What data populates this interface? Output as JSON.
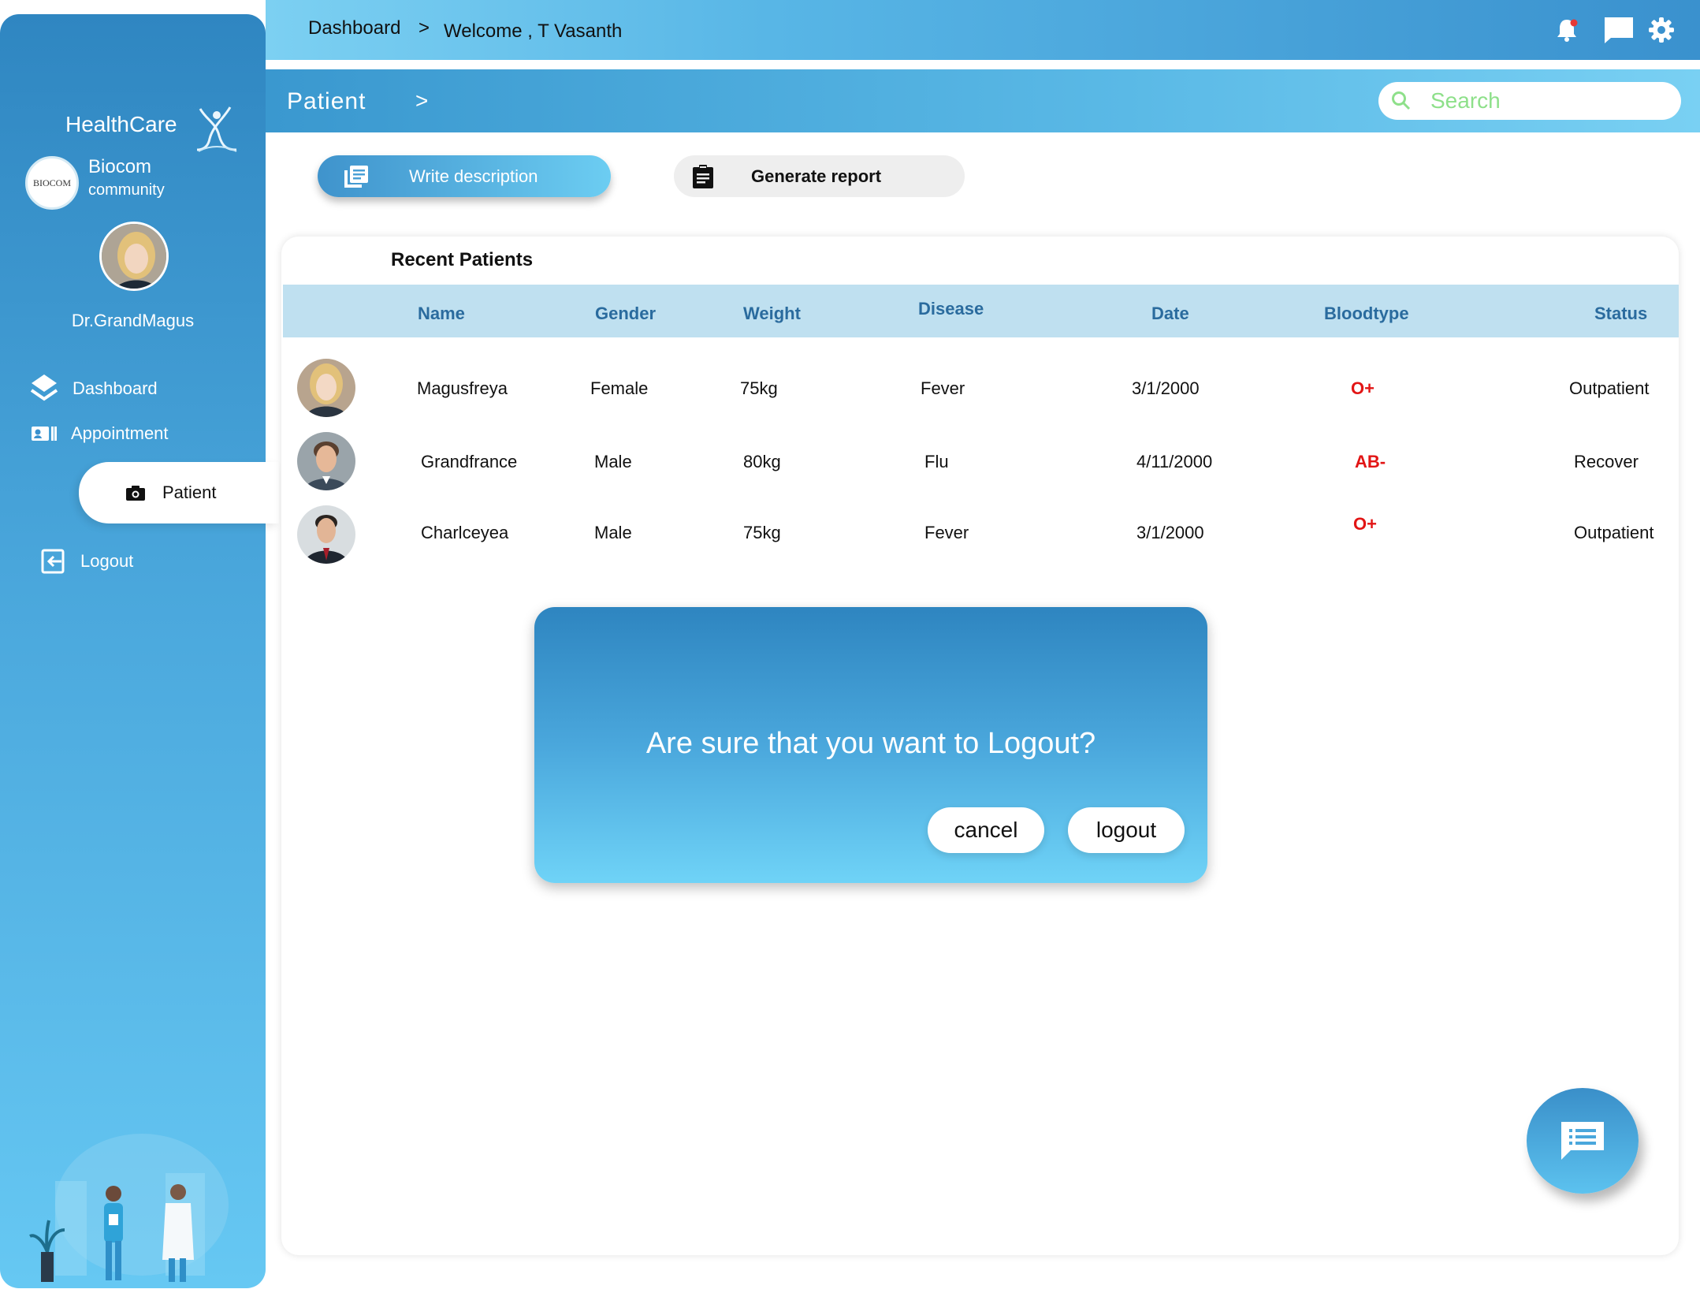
{
  "sidebar": {
    "brand": "HealthCare",
    "org_logo_text": "BIOCOM",
    "org_name": "Biocom",
    "org_sub": "community",
    "user_name": "Dr.GrandMagus",
    "nav": {
      "dashboard": "Dashboard",
      "appointment": "Appointment",
      "patient": "Patient",
      "logout": "Logout"
    },
    "active_item": "Patient"
  },
  "topbar": {
    "crumb_1": "Dashboard",
    "crumb_sep": ">",
    "welcome": "Welcome , T Vasanth",
    "icons": [
      "bell-icon",
      "chat-icon",
      "gear-icon"
    ]
  },
  "subbar": {
    "title": "Patient",
    "chevron": ">",
    "search_placeholder": "Search"
  },
  "actions": {
    "write_description": "Write description",
    "generate_report": "Generate report"
  },
  "recent": {
    "title": "Recent Patients",
    "columns": {
      "name": "Name",
      "gender": "Gender",
      "weight": "Weight",
      "disease": "Disease",
      "date": "Date",
      "bloodtype": "Bloodtype",
      "status": "Status"
    },
    "rows": [
      {
        "name": "Magusfreya",
        "gender": "Female",
        "weight": "75kg",
        "disease": "Fever",
        "date": "3/1/2000",
        "bloodtype": "O+",
        "status": "Outpatient"
      },
      {
        "name": "Grandfrance",
        "gender": "Male",
        "weight": "80kg",
        "disease": "Flu",
        "date": "4/11/2000",
        "bloodtype": "AB-",
        "status": "Recover"
      },
      {
        "name": "Charlceyea",
        "gender": "Male",
        "weight": "75kg",
        "disease": "Fever",
        "date": "3/1/2000",
        "bloodtype": "O+",
        "status": "Outpatient"
      }
    ]
  },
  "modal": {
    "message": "Are sure that you want to Logout?",
    "cancel": "cancel",
    "logout": "logout"
  },
  "colors": {
    "accent": "#3a91ce",
    "accent_light": "#6ccdf2",
    "blood_red": "#e21515",
    "header_bg": "#bfe0f0",
    "header_text": "#2a6b9e",
    "search_placeholder": "#8ee08a"
  }
}
